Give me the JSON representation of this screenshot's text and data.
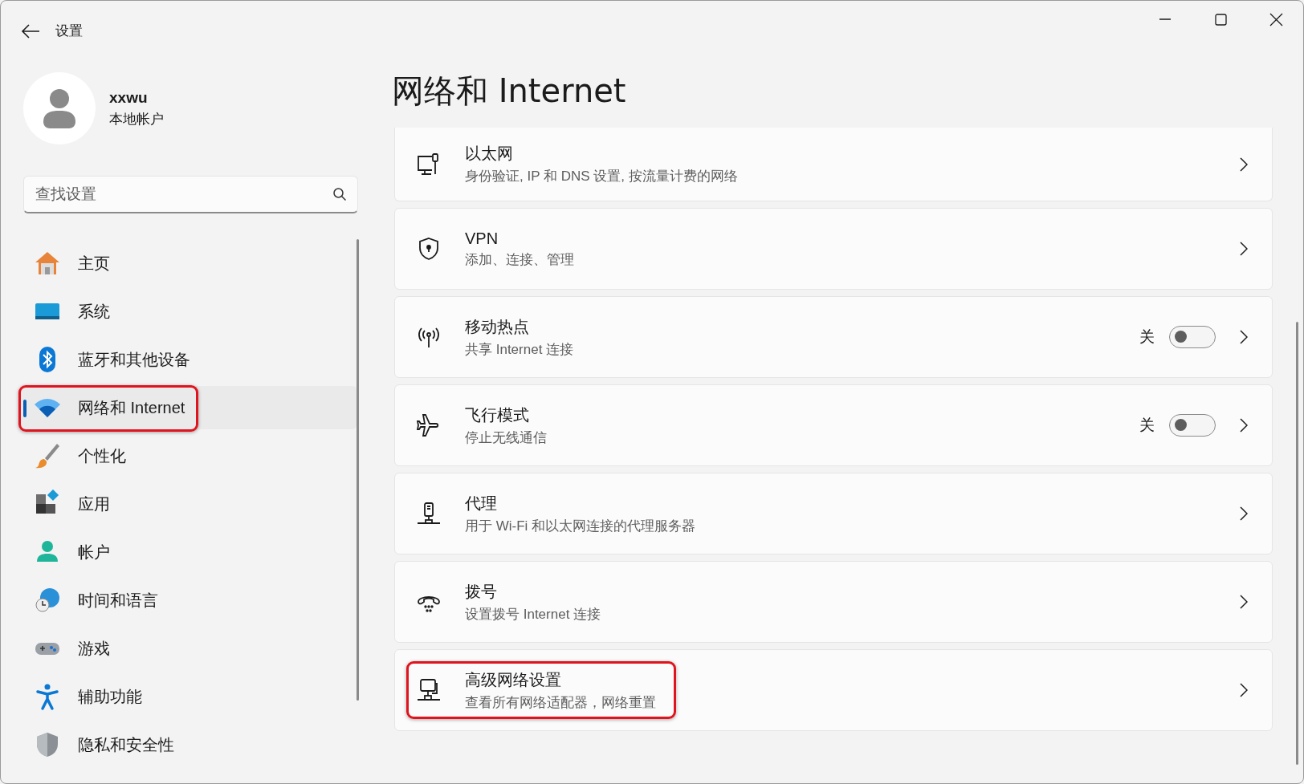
{
  "window": {
    "title": "设置"
  },
  "account": {
    "name": "xxwu",
    "type": "本地帐户"
  },
  "search": {
    "placeholder": "查找设置"
  },
  "sidebar": {
    "items": [
      {
        "label": "主页",
        "selected": false,
        "highlighted": false
      },
      {
        "label": "系统",
        "selected": false,
        "highlighted": false
      },
      {
        "label": "蓝牙和其他设备",
        "selected": false,
        "highlighted": false
      },
      {
        "label": "网络和 Internet",
        "selected": true,
        "highlighted": true
      },
      {
        "label": "个性化",
        "selected": false,
        "highlighted": false
      },
      {
        "label": "应用",
        "selected": false,
        "highlighted": false
      },
      {
        "label": "帐户",
        "selected": false,
        "highlighted": false
      },
      {
        "label": "时间和语言",
        "selected": false,
        "highlighted": false
      },
      {
        "label": "游戏",
        "selected": false,
        "highlighted": false
      },
      {
        "label": "辅助功能",
        "selected": false,
        "highlighted": false
      },
      {
        "label": "隐私和安全性",
        "selected": false,
        "highlighted": false
      }
    ]
  },
  "page": {
    "title": "网络和 Internet"
  },
  "cards": [
    {
      "kind": "link",
      "title": "以太网",
      "subtitle": "身份验证, IP 和 DNS 设置, 按流量计费的网络",
      "highlighted": false
    },
    {
      "kind": "link",
      "title": "VPN",
      "subtitle": "添加、连接、管理",
      "highlighted": false
    },
    {
      "kind": "toggle",
      "title": "移动热点",
      "subtitle": "共享 Internet 连接",
      "state_label": "关",
      "on": false,
      "highlighted": false
    },
    {
      "kind": "toggle",
      "title": "飞行模式",
      "subtitle": "停止无线通信",
      "state_label": "关",
      "on": false,
      "highlighted": false
    },
    {
      "kind": "link",
      "title": "代理",
      "subtitle": "用于 Wi-Fi 和以太网连接的代理服务器",
      "highlighted": false
    },
    {
      "kind": "link",
      "title": "拨号",
      "subtitle": "设置拨号 Internet 连接",
      "highlighted": false
    },
    {
      "kind": "link",
      "title": "高级网络设置",
      "subtitle": "查看所有网络适配器，网络重置",
      "highlighted": true
    }
  ]
}
